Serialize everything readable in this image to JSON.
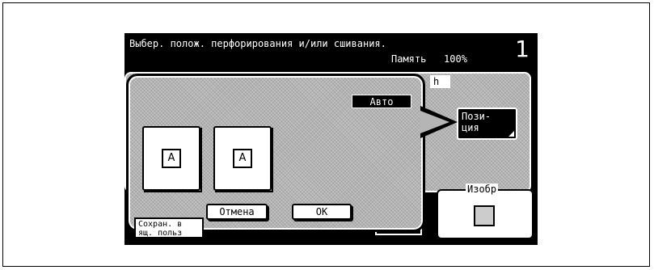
{
  "header": {
    "instruction": "Выбер. полож. перфорирования и/или сшивания.",
    "memory_text": "Память   100%",
    "page_number": "1"
  },
  "background_panel": {
    "tab_label": "h",
    "position_button_label": "Пози-\nция",
    "image_label": "Изобр"
  },
  "popup": {
    "auto_label": "Авто",
    "options": [
      {
        "icon_letter": "A",
        "position": "left"
      },
      {
        "icon_letter": "A",
        "position": "top"
      }
    ],
    "cancel_label": "Отмена",
    "ok_label": "OK"
  },
  "save": {
    "label": "Сохран. в\nящ. польз"
  }
}
